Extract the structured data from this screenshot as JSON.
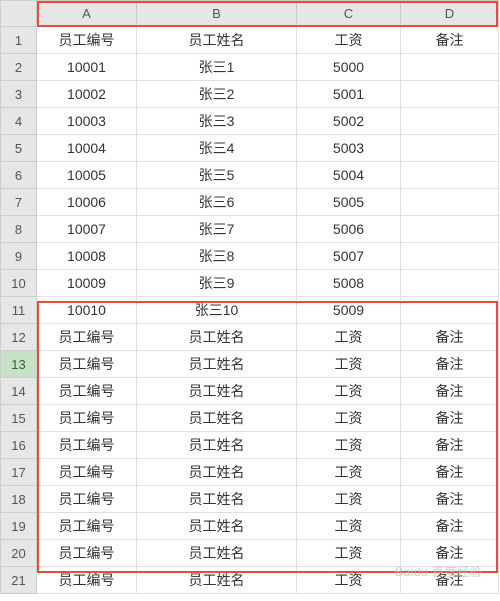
{
  "columns": [
    "A",
    "B",
    "C",
    "D"
  ],
  "rows": [
    {
      "n": 1,
      "A": "员工编号",
      "B": "员工姓名",
      "C": "工资",
      "D": "备注"
    },
    {
      "n": 2,
      "A": "10001",
      "B": "张三1",
      "C": "5000",
      "D": ""
    },
    {
      "n": 3,
      "A": "10002",
      "B": "张三2",
      "C": "5001",
      "D": ""
    },
    {
      "n": 4,
      "A": "10003",
      "B": "张三3",
      "C": "5002",
      "D": ""
    },
    {
      "n": 5,
      "A": "10004",
      "B": "张三4",
      "C": "5003",
      "D": ""
    },
    {
      "n": 6,
      "A": "10005",
      "B": "张三5",
      "C": "5004",
      "D": ""
    },
    {
      "n": 7,
      "A": "10006",
      "B": "张三6",
      "C": "5005",
      "D": ""
    },
    {
      "n": 8,
      "A": "10007",
      "B": "张三7",
      "C": "5006",
      "D": ""
    },
    {
      "n": 9,
      "A": "10008",
      "B": "张三8",
      "C": "5007",
      "D": ""
    },
    {
      "n": 10,
      "A": "10009",
      "B": "张三9",
      "C": "5008",
      "D": ""
    },
    {
      "n": 11,
      "A": "10010",
      "B": "张三10",
      "C": "5009",
      "D": ""
    },
    {
      "n": 12,
      "A": "员工编号",
      "B": "员工姓名",
      "C": "工资",
      "D": "备注"
    },
    {
      "n": 13,
      "A": "员工编号",
      "B": "员工姓名",
      "C": "工资",
      "D": "备注"
    },
    {
      "n": 14,
      "A": "员工编号",
      "B": "员工姓名",
      "C": "工资",
      "D": "备注"
    },
    {
      "n": 15,
      "A": "员工编号",
      "B": "员工姓名",
      "C": "工资",
      "D": "备注"
    },
    {
      "n": 16,
      "A": "员工编号",
      "B": "员工姓名",
      "C": "工资",
      "D": "备注"
    },
    {
      "n": 17,
      "A": "员工编号",
      "B": "员工姓名",
      "C": "工资",
      "D": "备注"
    },
    {
      "n": 18,
      "A": "员工编号",
      "B": "员工姓名",
      "C": "工资",
      "D": "备注"
    },
    {
      "n": 19,
      "A": "员工编号",
      "B": "员工姓名",
      "C": "工资",
      "D": "备注"
    },
    {
      "n": 20,
      "A": "员工编号",
      "B": "员工姓名",
      "C": "工资",
      "D": "备注"
    },
    {
      "n": 21,
      "A": "员工编号",
      "B": "员工姓名",
      "C": "工资",
      "D": "备注"
    }
  ],
  "selected_row": 13,
  "watermark": "Baidu 百度经验"
}
